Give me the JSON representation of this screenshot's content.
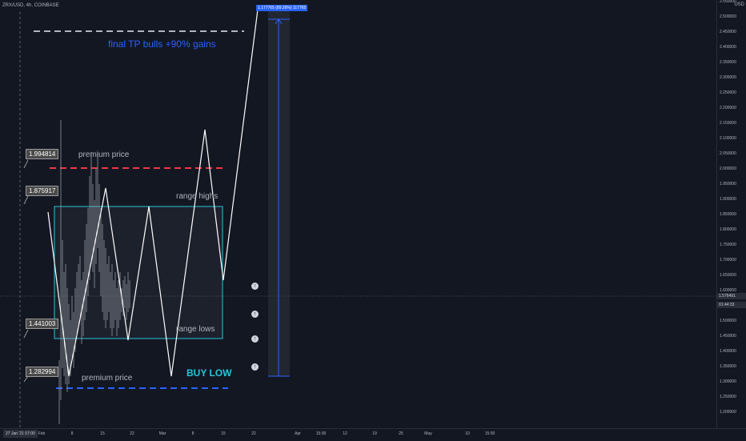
{
  "header": {
    "symbol": "ZRX/USD, 4h, COINBASE",
    "currency": "USD"
  },
  "annotations": {
    "final_tp": "final TP bulls +90% gains",
    "premium_top": "premium price",
    "range_highs": "range highs",
    "range_lows": "range lows",
    "premium_bottom": "premium price",
    "buy_low": "BUY LOW",
    "tp_measure": "1.177765 (89.26%) 117765"
  },
  "callouts": [
    "1.994814",
    "1.875917",
    "1.441003",
    "1.282994"
  ],
  "price_axis": {
    "ticks": [
      "2.550000",
      "2.500000",
      "2.450000",
      "2.400000",
      "2.350000",
      "2.300000",
      "2.250000",
      "2.200000",
      "2.150000",
      "2.100000",
      "2.050000",
      "2.000000",
      "1.950000",
      "1.900000",
      "1.850000",
      "1.800000",
      "1.750000",
      "1.700000",
      "1.650000",
      "1.600000",
      "1.550000",
      "1.500000",
      "1.450000",
      "1.400000",
      "1.350000",
      "1.300000",
      "1.250000",
      "1.200000"
    ],
    "current_price": "1.576491",
    "countdown": "01:44:33"
  },
  "time_axis": {
    "start": "27 Jan '21  07:00",
    "ticks": [
      "Feb",
      "8",
      "15",
      "22",
      "Mar",
      "8",
      "15",
      "22",
      "Apr",
      "15:00",
      "12",
      "19",
      "25",
      "May",
      "10",
      "15:00"
    ]
  },
  "colors": {
    "background": "#131722",
    "range_box": "#26c6da",
    "premium_top": "#f23645",
    "premium_bottom": "#2962ff",
    "tp_text": "#2962ff",
    "buy_low": "#26c6da"
  },
  "icons": [
    "arrow-up-circle-icon",
    "arrow-up-circle-icon",
    "arrow-up-circle-icon",
    "arrow-up-circle-icon"
  ]
}
